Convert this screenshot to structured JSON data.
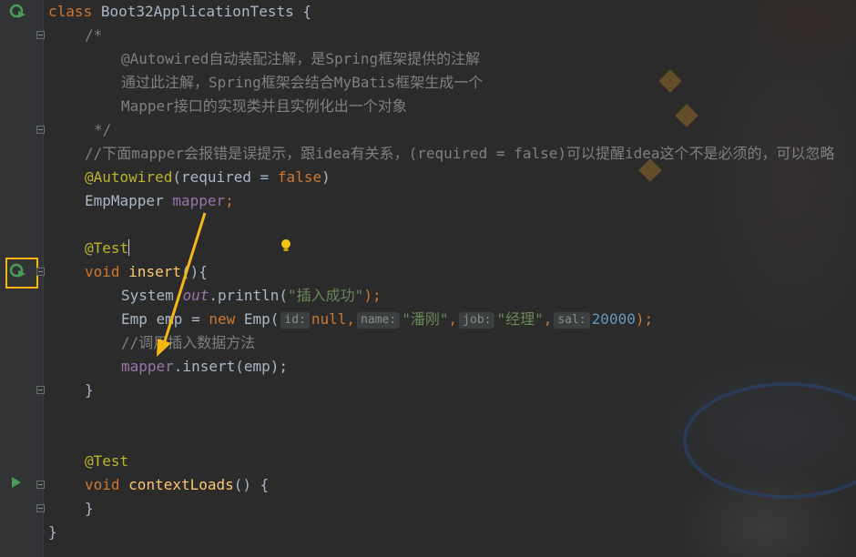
{
  "editor": {
    "class_decl": {
      "kw": "class",
      "name": "Boot32ApplicationTests",
      "brace": "{"
    },
    "comment": {
      "open": "/*",
      "line1": "@Autowired自动装配注解，是Spring框架提供的注解",
      "line2": "通过此注解，Spring框架会结合MyBatis框架生成一个",
      "line3": "Mapper接口的实现类并且实例化出一个对象",
      "close": "*/"
    },
    "line_comment": "//下面mapper会报错是误提示，跟idea有关系，(required = false)可以提醒idea这个不是必须的，可以忽略",
    "autowired": {
      "ann": "@Autowired",
      "open": "(required = ",
      "value": "false",
      "close": ")"
    },
    "field_decl": {
      "type": "EmpMapper ",
      "name": "mapper",
      "semi": ";"
    },
    "test_ann": "@Test",
    "insert_method": {
      "kw": "void",
      "name": "insert",
      "sig": "(){"
    },
    "println": {
      "obj": "System.",
      "field": "out",
      "call": ".println(",
      "arg": "\"插入成功\"",
      "end": ");"
    },
    "emp_new": {
      "decl": "Emp emp = ",
      "kw_new": "new",
      "ctor": " Emp(",
      "hint_id": "id:",
      "val_id": "null",
      "hint_name": "name:",
      "val_name": "\"潘刚\"",
      "hint_job": "job:",
      "val_job": "\"经理\"",
      "hint_sal": "sal:",
      "val_sal": "20000",
      "end": ");"
    },
    "insert_comment": "//调用插入数据方法",
    "mapper_call": {
      "obj": "mapper",
      "rest": ".insert(emp);"
    },
    "close_brace": "}",
    "test_ann2": "@Test",
    "context_method": {
      "kw": "void",
      "name": "contextLoads",
      "sig": "() {"
    },
    "close_brace2": "}",
    "class_close": "}"
  },
  "colors": {
    "keyword": "#cc7832",
    "annotation": "#bbb529",
    "comment": "#808080",
    "method": "#ffc66d",
    "string": "#6a8759",
    "number": "#6897bb",
    "field": "#9876aa",
    "highlight_box": "#f5b715",
    "arrow": "#f5b715"
  },
  "icons": {
    "gutter_run": "run-test-icon",
    "gutter_play": "play-icon",
    "intention": "lightbulb-icon"
  }
}
